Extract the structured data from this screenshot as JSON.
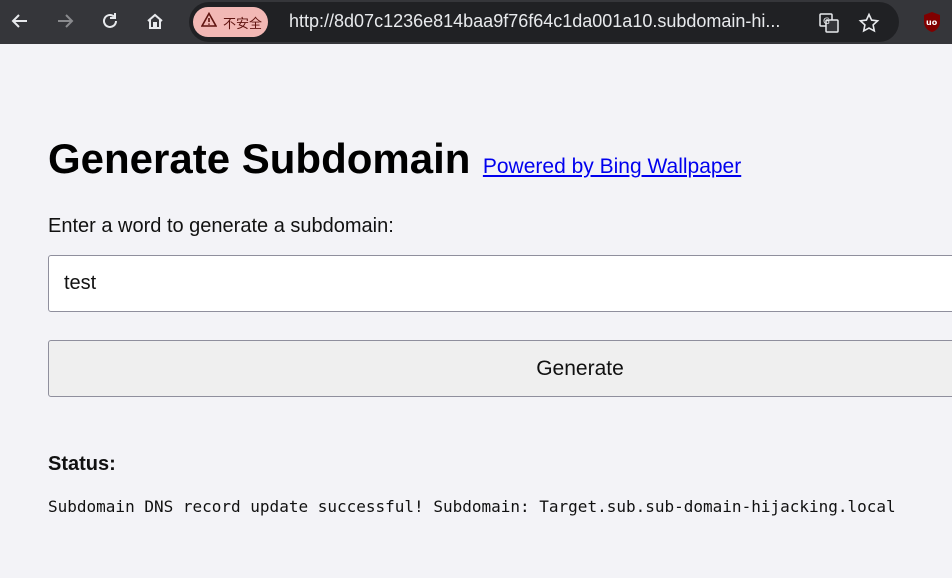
{
  "browser": {
    "security_label": "不安全",
    "url": "http://8d07c1236e814baa9f76f64c1da001a10.subdomain-hi...",
    "icons": [
      "back-icon",
      "forward-icon",
      "reload-icon",
      "home-icon",
      "warning-icon",
      "translate-icon",
      "star-icon",
      "ublock-icon"
    ]
  },
  "page": {
    "title": "Generate Subdomain",
    "powered_link": "Powered by Bing Wallpaper",
    "prompt": "Enter a word to generate a subdomain:",
    "input_value": "test",
    "button_label": "Generate",
    "status_label": "Status:",
    "status_message": "Subdomain DNS record update successful! Subdomain: Target.sub.sub-domain-hijacking.local"
  },
  "colors": {
    "chrome_bg": "#35363a",
    "omnibox_bg": "#202124",
    "insecure_badge": "#f2b8b5",
    "link": "#0000ee",
    "page_bg": "#f3f3f7"
  }
}
